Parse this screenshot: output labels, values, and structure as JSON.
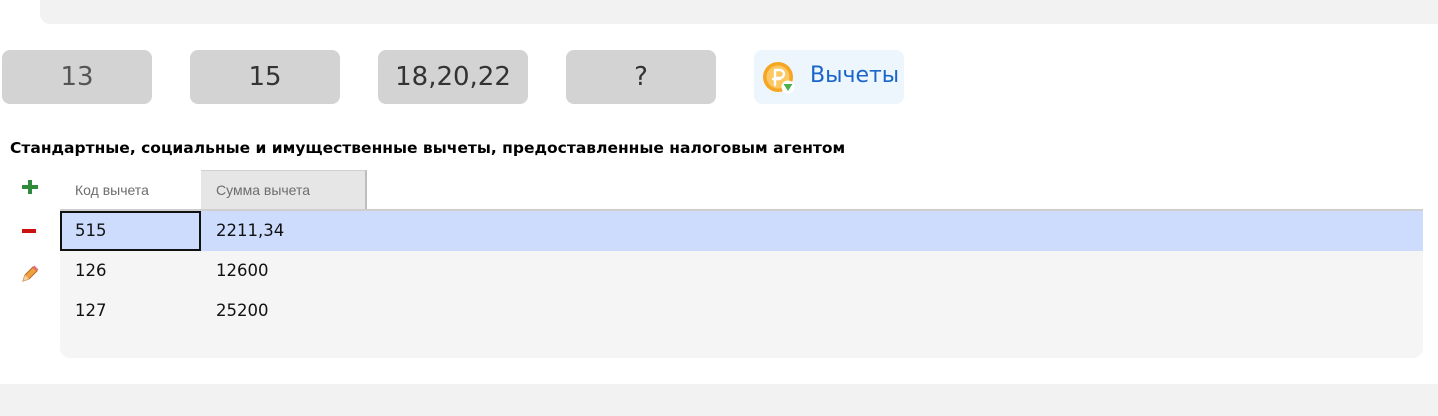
{
  "tabs": [
    {
      "label": "13"
    },
    {
      "label": "15"
    },
    {
      "label": "18,20,22"
    },
    {
      "label": "?"
    }
  ],
  "active_tab": {
    "label": "Вычеты",
    "icon": "ruble-icon"
  },
  "section": {
    "title": "Стандартные, социальные и имущественные вычеты, предоставленные налоговым агентом"
  },
  "toolbar": {
    "add_icon": "plus-icon",
    "remove_icon": "minus-icon",
    "edit_icon": "pencil-icon"
  },
  "table": {
    "columns": [
      "Код вычета",
      "Сумма вычета"
    ],
    "rows": [
      {
        "code": "515",
        "amount": "2211,34",
        "selected": true
      },
      {
        "code": "126",
        "amount": "12600"
      },
      {
        "code": "127",
        "amount": "25200"
      }
    ]
  },
  "colors": {
    "add": "#2e8b3c",
    "remove": "#cc1111",
    "selected_row": "#cddcfd",
    "link_blue": "#1a66c8"
  }
}
